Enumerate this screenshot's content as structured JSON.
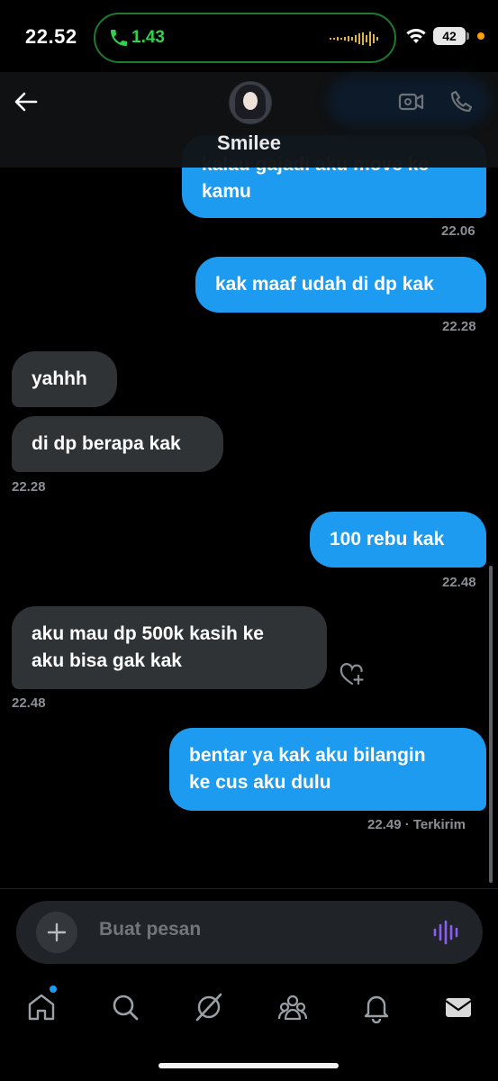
{
  "status_bar": {
    "time": "22.52",
    "call_duration": "1.43",
    "battery": "42"
  },
  "header": {
    "contact_name": "Smilee"
  },
  "messages": [
    {
      "direction": "out",
      "text": "kalau gajadi aku move ke kamu",
      "visible_text": "kamu",
      "time": "22.06"
    },
    {
      "direction": "out",
      "text": "kak maaf udah di dp kak",
      "time": "22.28"
    },
    {
      "direction": "in",
      "text": "yahhh"
    },
    {
      "direction": "in",
      "text": "di dp berapa kak",
      "time": "22.28"
    },
    {
      "direction": "out",
      "text": "100 rebu kak",
      "time": "22.48"
    },
    {
      "direction": "in",
      "text": "aku mau dp 500k kasih ke aku bisa gak kak",
      "time": "22.48"
    },
    {
      "direction": "out",
      "text": "bentar ya kak aku bilangin ke cus aku dulu",
      "time": "22.49",
      "status": "Terkirim"
    }
  ],
  "msg_text": {
    "m0_partial": "kalau gajadi aku move ke",
    "m0_line2": "kamu",
    "m5_line1": "aku mau dp 500k kasih ke",
    "m5_line2": "aku bisa gak kak",
    "m6_line1": "bentar ya kak aku bilangin",
    "m6_line2": "ke cus aku dulu",
    "m6_status": "22.49 · Terkirim"
  },
  "composer": {
    "placeholder": "Buat pesan"
  },
  "colors": {
    "outgoing_bubble": "#1d9bf0",
    "incoming_bubble": "#2f3336",
    "call_green": "#33d04f",
    "background": "#000000"
  },
  "icons": {
    "back": "arrow-left-icon",
    "video": "video-camera-icon",
    "phone": "phone-icon",
    "add": "plus-icon",
    "voice": "voice-waveform-icon",
    "react": "heart-plus-icon",
    "nav": [
      "home-icon",
      "search-icon",
      "grok-icon",
      "communities-icon",
      "notifications-icon",
      "messages-icon"
    ]
  }
}
